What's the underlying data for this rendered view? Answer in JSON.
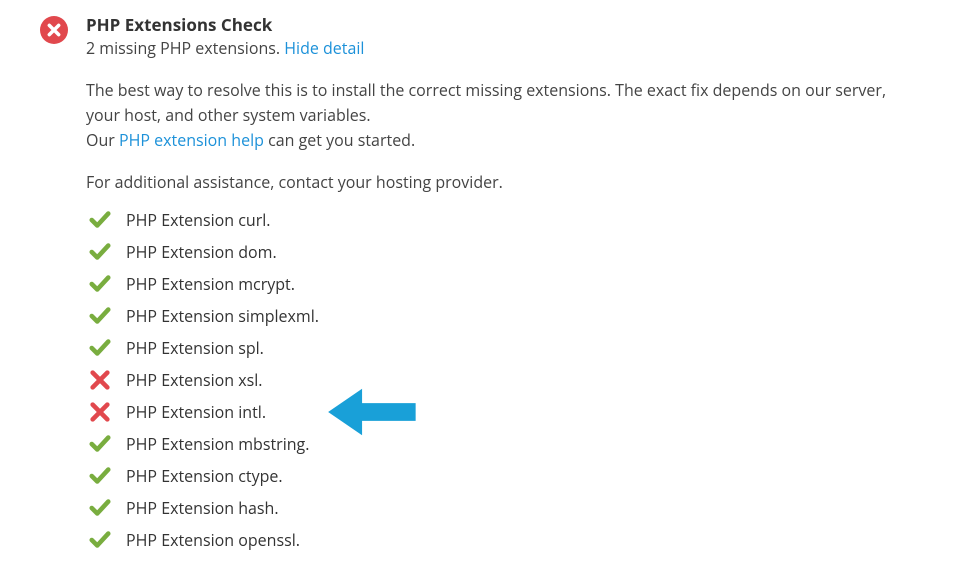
{
  "header": {
    "title": "PHP Extensions Check",
    "summary_prefix": "2 missing PHP extensions. ",
    "toggle_link": "Hide detail"
  },
  "body": {
    "p1": "The best way to resolve this is to install the correct missing extensions. The exact fix depends on our server, your host, and other system variables.",
    "p3_prefix": "Our ",
    "p3_link": "PHP extension help",
    "p3_suffix": " can get you started.",
    "p4": "For additional assistance, contact your hosting provider."
  },
  "extensions": [
    {
      "label": "PHP Extension curl.",
      "status": "ok"
    },
    {
      "label": "PHP Extension dom.",
      "status": "ok"
    },
    {
      "label": "PHP Extension mcrypt.",
      "status": "ok"
    },
    {
      "label": "PHP Extension simplexml.",
      "status": "ok"
    },
    {
      "label": "PHP Extension spl.",
      "status": "ok"
    },
    {
      "label": "PHP Extension xsl.",
      "status": "fail"
    },
    {
      "label": "PHP Extension intl.",
      "status": "fail"
    },
    {
      "label": "PHP Extension mbstring.",
      "status": "ok"
    },
    {
      "label": "PHP Extension ctype.",
      "status": "ok"
    },
    {
      "label": "PHP Extension hash.",
      "status": "ok"
    },
    {
      "label": "PHP Extension openssl.",
      "status": "ok"
    }
  ],
  "colors": {
    "ok": "#79ad3f",
    "fail": "#e1484d",
    "link": "#1c91d9",
    "arrow": "#19a0d8"
  }
}
